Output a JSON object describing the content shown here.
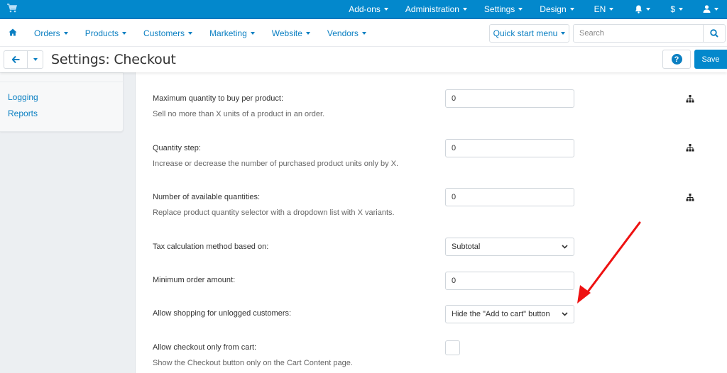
{
  "topbar": {
    "cart_icon": "shopping-cart-icon",
    "menu": [
      {
        "label": "Add-ons"
      },
      {
        "label": "Administration"
      },
      {
        "label": "Settings"
      },
      {
        "label": "Design"
      },
      {
        "label": "EN"
      },
      {
        "label": "",
        "icon": "bell-icon"
      },
      {
        "label": "$"
      },
      {
        "label": "",
        "icon": "user-icon"
      }
    ],
    "color": "#0388cc"
  },
  "nav": {
    "home_icon": "home-icon",
    "items": [
      {
        "label": "Orders"
      },
      {
        "label": "Products"
      },
      {
        "label": "Customers"
      },
      {
        "label": "Marketing"
      },
      {
        "label": "Website"
      },
      {
        "label": "Vendors"
      }
    ],
    "quick_start_label": "Quick start menu",
    "search": {
      "placeholder": "Search",
      "value": ""
    }
  },
  "titlebar": {
    "title": "Settings: Checkout",
    "help_label": "?",
    "save_label": "Save"
  },
  "sidebar": {
    "items": [
      {
        "label": "Logging"
      },
      {
        "label": "Reports"
      }
    ]
  },
  "settings": [
    {
      "label": "Maximum quantity to buy per product:",
      "description": "Sell no more than X units of a product in an order.",
      "type": "text",
      "value": "0",
      "tree_icon": true
    },
    {
      "label": "Quantity step:",
      "description": "Increase or decrease the number of purchased product units only by X.",
      "type": "text",
      "value": "0",
      "tree_icon": true
    },
    {
      "label": "Number of available quantities:",
      "description": "Replace product quantity selector with a dropdown list with X variants.",
      "type": "text",
      "value": "0",
      "tree_icon": true
    },
    {
      "label": "Tax calculation method based on:",
      "description": "",
      "type": "select",
      "value": "Subtotal"
    },
    {
      "label": "Minimum order amount:",
      "description": "",
      "type": "text",
      "value": "0"
    },
    {
      "label": "Allow shopping for unlogged customers:",
      "description": "",
      "type": "select",
      "value": "Hide the \"Add to cart\" button"
    },
    {
      "label": "Allow checkout only from cart:",
      "description": "Show the Checkout button only on the Cart Content page.",
      "type": "checkbox",
      "checked": false
    }
  ],
  "annotation": {
    "type": "arrow",
    "color": "#ee1111",
    "points_to": "Allow shopping for unlogged customers select"
  }
}
